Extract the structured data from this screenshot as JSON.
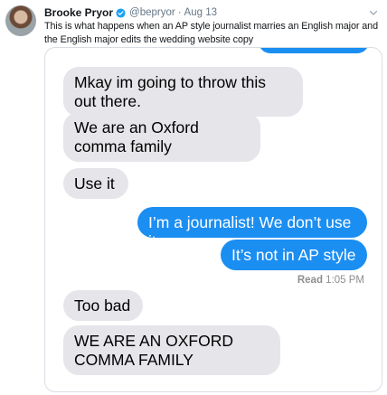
{
  "tweet": {
    "display_name": "Brooke Pryor",
    "handle": "@bepryor",
    "separator": "·",
    "date": "Aug 13",
    "text": "This is what happens when an AP style journalist marries an English major and the English major edits the wedding website copy"
  },
  "conversation": {
    "messages": [
      {
        "direction": "received",
        "text": "Mkay im going to throw this out there."
      },
      {
        "direction": "received",
        "text": "We are an Oxford comma family"
      },
      {
        "direction": "received",
        "text": "Use it"
      },
      {
        "direction": "sent",
        "text": "I’m a journalist! We don’t use it"
      },
      {
        "direction": "sent",
        "text": "It’s not in AP style"
      },
      {
        "direction": "received",
        "text": "Too bad"
      },
      {
        "direction": "received",
        "text": "WE ARE AN OXFORD COMMA FAMILY"
      }
    ],
    "read_label": "Read",
    "read_time": "1:05 PM"
  },
  "colors": {
    "received_bubble": "#e5e5ea",
    "sent_bubble": "#1b8ef2",
    "verified_badge": "#1da1f2",
    "secondary_text": "#657786"
  },
  "icons": [
    "verified-badge-icon",
    "chevron-down-icon"
  ]
}
